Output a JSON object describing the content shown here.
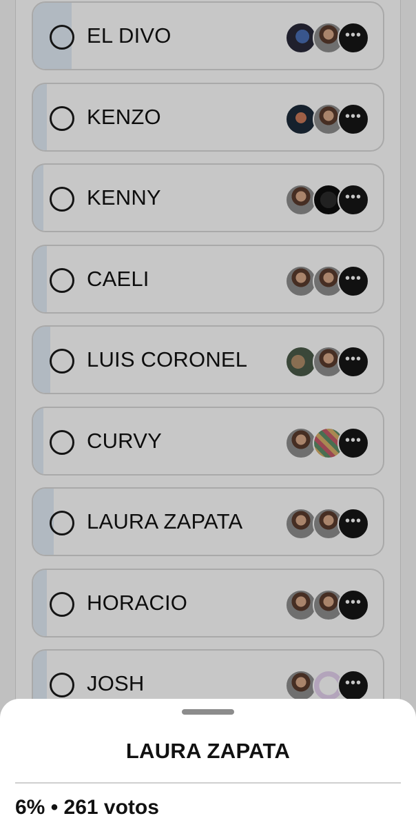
{
  "poll": {
    "options": [
      {
        "label": "EL DIVO",
        "percent": 11,
        "avatars": [
          "flag-avatar",
          "person-avatar"
        ],
        "more_icon": "ellipsis-icon"
      },
      {
        "label": "KENZO",
        "percent": 4,
        "avatars": [
          "heart-photo-avatar",
          "person-avatar"
        ],
        "more_icon": "ellipsis-icon"
      },
      {
        "label": "KENNY",
        "percent": 3,
        "avatars": [
          "person-avatar",
          "dark-avatar"
        ],
        "more_icon": "ellipsis-icon"
      },
      {
        "label": "CAELI",
        "percent": 4,
        "avatars": [
          "person-avatar",
          "person-avatar"
        ],
        "more_icon": "ellipsis-icon"
      },
      {
        "label": "LUIS CORONEL",
        "percent": 5,
        "avatars": [
          "dog-photo-avatar",
          "person-avatar"
        ],
        "more_icon": "ellipsis-icon"
      },
      {
        "label": "CURVY",
        "percent": 3,
        "avatars": [
          "person-avatar",
          "group-photo-avatar"
        ],
        "more_icon": "ellipsis-icon"
      },
      {
        "label": "LAURA ZAPATA",
        "percent": 6,
        "avatars": [
          "person-avatar",
          "person-avatar"
        ],
        "more_icon": "ellipsis-icon"
      },
      {
        "label": "HORACIO",
        "percent": 4,
        "avatars": [
          "person-avatar",
          "person-avatar"
        ],
        "more_icon": "ellipsis-icon"
      },
      {
        "label": "JOSH",
        "percent": 4,
        "avatars": [
          "person-avatar",
          "logo-avatar"
        ],
        "more_icon": "ellipsis-icon"
      }
    ],
    "more_glyph": "•••"
  },
  "sheet": {
    "title": "LAURA ZAPATA",
    "stats": "6% • 261 votos"
  },
  "colors": {
    "fill": "#e3eef8",
    "border": "#d9d9d9",
    "overlay": "rgba(0,0,0,0.22)"
  }
}
